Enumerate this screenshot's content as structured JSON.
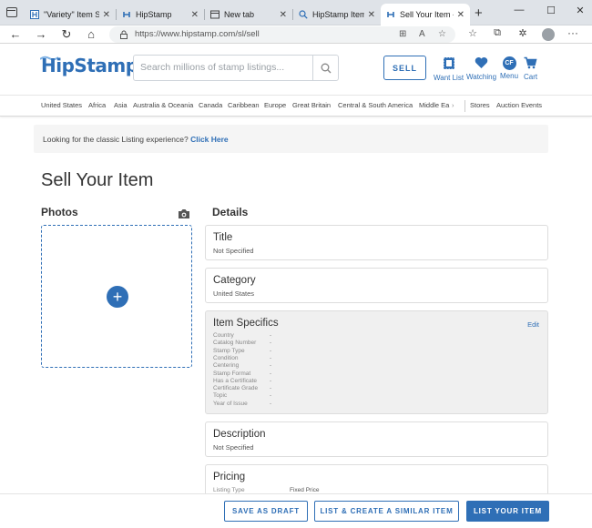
{
  "browser": {
    "tabs": [
      {
        "title": "\"Variety\" Item Sp"
      },
      {
        "title": "HipStamp"
      },
      {
        "title": "New tab"
      },
      {
        "title": "HipStamp Item S"
      },
      {
        "title": "Sell Your Item - H"
      }
    ],
    "url": "https://www.hipstamp.com/sl/sell"
  },
  "header": {
    "logo_hip": "Hip",
    "logo_stamp": "Stamp",
    "search_placeholder": "Search millions of stamp listings...",
    "sell_label": "SELL",
    "want_list": "Want List",
    "watching": "Watching",
    "menu_initials": "CF",
    "menu": "Menu",
    "cart": "Cart"
  },
  "categories": [
    "United States",
    "Africa",
    "Asia",
    "Australia & Oceania",
    "Canada",
    "Caribbean",
    "Europe",
    "Great Britain",
    "Central & South America",
    "Middle Ea"
  ],
  "nav_right": [
    "Stores",
    "Auction Events"
  ],
  "banner": {
    "text": "Looking for the classic Listing experience?",
    "link": "Click Here"
  },
  "page": {
    "title": "Sell Your Item",
    "photos_heading": "Photos",
    "details_heading": "Details"
  },
  "details": {
    "title": {
      "label": "Title",
      "value": "Not Specified"
    },
    "category": {
      "label": "Category",
      "value": "United States"
    },
    "item_specifics": {
      "label": "Item Specifics",
      "edit": "Edit",
      "rows": [
        {
          "name": "Country",
          "value": "-"
        },
        {
          "name": "Catalog Number",
          "value": "-"
        },
        {
          "name": "Stamp Type",
          "value": "-"
        },
        {
          "name": "Condition",
          "value": "-"
        },
        {
          "name": "Centering",
          "value": "-"
        },
        {
          "name": "Stamp Format",
          "value": "-"
        },
        {
          "name": "Has a Certificate",
          "value": "-"
        },
        {
          "name": "Certificate Grade",
          "value": "-"
        },
        {
          "name": "Topic",
          "value": "-"
        },
        {
          "name": "Year of Issue",
          "value": "-"
        }
      ]
    },
    "description": {
      "label": "Description",
      "value": "Not Specified"
    },
    "pricing": {
      "label": "Pricing",
      "listing_type_label": "Listing Type",
      "listing_type_value": "Fixed Price"
    }
  },
  "actions": {
    "save_draft": "SAVE AS DRAFT",
    "list_similar": "LIST & CREATE A SIMILAR ITEM",
    "list_item": "LIST YOUR ITEM"
  },
  "colors": {
    "brand": "#2f6fb6"
  }
}
